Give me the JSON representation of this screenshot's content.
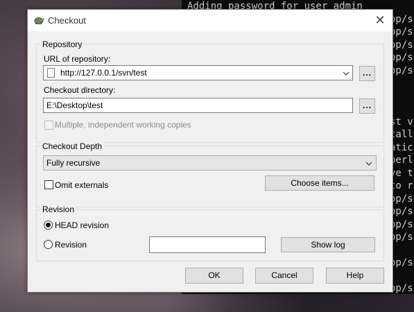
{
  "terminal": {
    "lines": [
      "Adding password for user admin",
      "op/s",
      "op/s",
      "op/s",
      "op/s",
      "op/s",
      "",
      "",
      "",
      "st v",
      "tall",
      "atic",
      "perl",
      "ve t",
      "to r",
      "op/s",
      "op/s",
      "op/s",
      "op/s",
      "",
      "op/s",
      "",
      "op/s"
    ]
  },
  "dialog": {
    "title": "Checkout",
    "close_glyph": "✕",
    "repository": {
      "group_label": "Repository",
      "url_label": "URL of repository:",
      "url_value": "http://127.0.0.1/svn/test",
      "url_browse": "...",
      "dir_label": "Checkout directory:",
      "dir_value": "E:\\Desktop\\test",
      "dir_browse": "...",
      "multi_wc_label": "Multiple, independent working copies"
    },
    "depth": {
      "group_label": "Checkout Depth",
      "selected": "Fully recursive",
      "omit_externals_label": "Omit externals",
      "choose_items_button": "Choose items..."
    },
    "revision": {
      "group_label": "Revision",
      "head_label": "HEAD revision",
      "revision_label": "Revision",
      "revision_value": "",
      "show_log_button": "Show log"
    },
    "buttons": {
      "ok": "OK",
      "cancel": "Cancel",
      "help": "Help"
    }
  }
}
